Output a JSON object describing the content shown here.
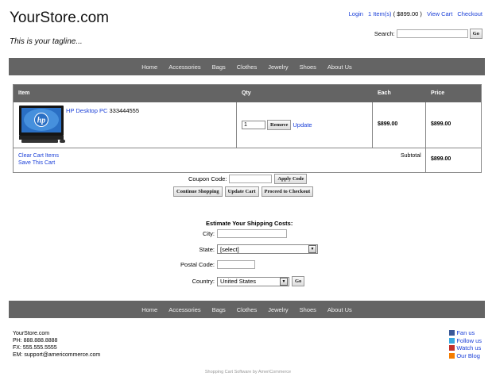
{
  "header": {
    "store_name": "YourStore.com",
    "tagline": "This is your tagline...",
    "links": {
      "login": "Login",
      "items": "1 Item(s)",
      "total": "( $899.00 )",
      "view_cart": "View Cart",
      "checkout": "Checkout"
    },
    "search_label": "Search:",
    "search_button": "Go"
  },
  "nav": [
    "Home",
    "Accessories",
    "Bags",
    "Clothes",
    "Jewelry",
    "Shoes",
    "About Us"
  ],
  "cart": {
    "columns": {
      "item": "Item",
      "qty": "Qty",
      "each": "Each",
      "price": "Price"
    },
    "rows": [
      {
        "name": "HP Desktop PC",
        "sku": "333444555",
        "qty": "1",
        "each": "$899.00",
        "price": "$899.00",
        "remove": "Remove",
        "update": "Update"
      }
    ],
    "clear": "Clear Cart Items",
    "save": "Save This Cart",
    "subtotal_label": "Subtotal",
    "subtotal": "$899.00"
  },
  "coupon": {
    "label": "Coupon Code:",
    "button": "Apply Code"
  },
  "actions": {
    "continue": "Continue Shopping",
    "update": "Update Cart",
    "proceed": "Proceed to Checkout"
  },
  "shipping": {
    "title": "Estimate Your Shipping Costs:",
    "city_label": "City:",
    "state_label": "State:",
    "state_value": "[select]",
    "postal_label": "Postal Code:",
    "country_label": "Country:",
    "country_value": "United States",
    "go": "Go"
  },
  "footer": {
    "company": "YourStore.com",
    "phone": "PH: 888.888.8888",
    "fax": "FX: 555.555.5555",
    "email": "EM: support@americommerce.com",
    "credit": "Shopping Cart Software by AmeriCommerce",
    "social": {
      "facebook": "Fan us",
      "twitter": "Follow us",
      "youtube": "Watch us",
      "blog": "Our Blog"
    }
  },
  "colors": {
    "nav_bg": "#646464",
    "link": "#1a3fd8"
  }
}
